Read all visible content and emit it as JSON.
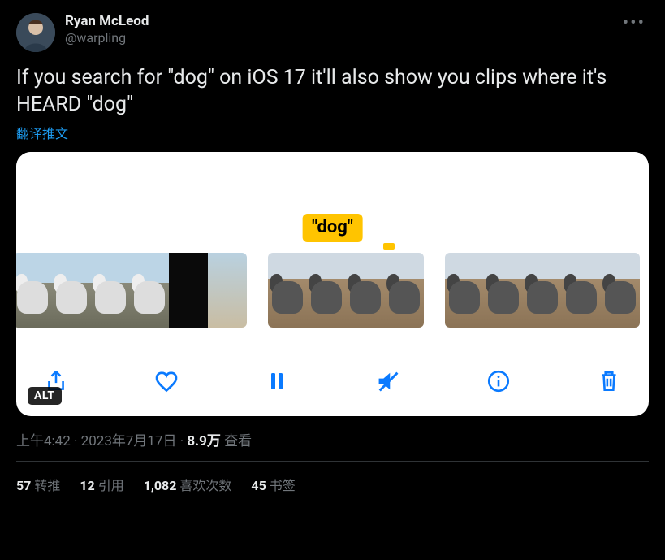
{
  "author": {
    "display_name": "Ryan McLeod",
    "handle": "@warpling"
  },
  "body_text": "If you search for \"dog\" on iOS 17 it'll also show you clips where it's HEARD \"dog\"",
  "translate_label": "翻译推文",
  "media": {
    "search_tag": "\"dog\"",
    "alt_badge": "ALT"
  },
  "meta": {
    "time": "上午4:42",
    "separator": " · ",
    "date": "2023年7月17日",
    "views_num": "8.9万",
    "views_label": " 查看"
  },
  "stats": {
    "retweets_num": "57",
    "retweets_label": "转推",
    "quotes_num": "12",
    "quotes_label": "引用",
    "likes_num": "1,082",
    "likes_label": "喜欢次数",
    "bookmarks_num": "45",
    "bookmarks_label": "书签"
  }
}
